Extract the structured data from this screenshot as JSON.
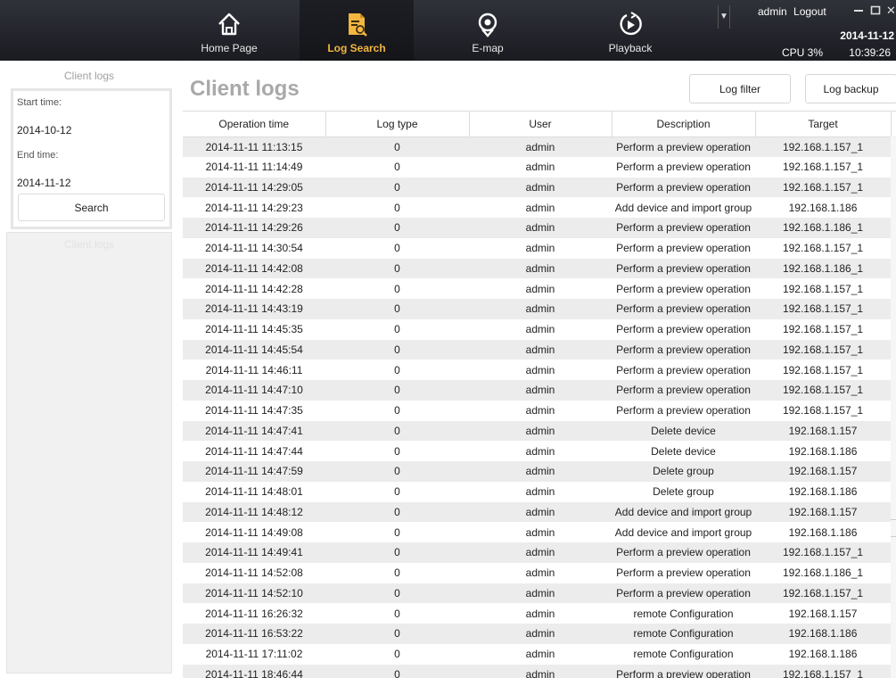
{
  "nav": {
    "items": [
      {
        "label": "Home Page",
        "icon": "home-icon"
      },
      {
        "label": "Log Search",
        "icon": "log-search-icon"
      },
      {
        "label": "E-map",
        "icon": "map-pin-icon"
      },
      {
        "label": "Playback",
        "icon": "playback-icon"
      }
    ],
    "active": "Log Search",
    "active_color": "#f3b640"
  },
  "header": {
    "user": "admin",
    "logout": "Logout",
    "date": "2014-11-12",
    "cpu": "CPU 3%",
    "time": "10:39:26"
  },
  "sidebar": {
    "title": "Client logs",
    "start_label": "Start time:",
    "start_value": "2014-10-12",
    "end_label": "End time:",
    "end_value": "2014-11-12",
    "search_label": "Search",
    "lower_title": "Client logs"
  },
  "main": {
    "title": "Client logs",
    "log_filter_label": "Log filter",
    "log_backup_label": "Log backup"
  },
  "table": {
    "columns": [
      "Operation time",
      "Log type",
      "User",
      "Description",
      "Target"
    ],
    "rows": [
      [
        "2014-11-11 11:13:15",
        "0",
        "admin",
        "Perform a preview operation",
        "192.168.1.157_1"
      ],
      [
        "2014-11-11 11:14:49",
        "0",
        "admin",
        "Perform a preview operation",
        "192.168.1.157_1"
      ],
      [
        "2014-11-11 14:29:05",
        "0",
        "admin",
        "Perform a preview operation",
        "192.168.1.157_1"
      ],
      [
        "2014-11-11 14:29:23",
        "0",
        "admin",
        "Add device and import group",
        "192.168.1.186"
      ],
      [
        "2014-11-11 14:29:26",
        "0",
        "admin",
        "Perform a preview operation",
        "192.168.1.186_1"
      ],
      [
        "2014-11-11 14:30:54",
        "0",
        "admin",
        "Perform a preview operation",
        "192.168.1.157_1"
      ],
      [
        "2014-11-11 14:42:08",
        "0",
        "admin",
        "Perform a preview operation",
        "192.168.1.186_1"
      ],
      [
        "2014-11-11 14:42:28",
        "0",
        "admin",
        "Perform a preview operation",
        "192.168.1.157_1"
      ],
      [
        "2014-11-11 14:43:19",
        "0",
        "admin",
        "Perform a preview operation",
        "192.168.1.157_1"
      ],
      [
        "2014-11-11 14:45:35",
        "0",
        "admin",
        "Perform a preview operation",
        "192.168.1.157_1"
      ],
      [
        "2014-11-11 14:45:54",
        "0",
        "admin",
        "Perform a preview operation",
        "192.168.1.157_1"
      ],
      [
        "2014-11-11 14:46:11",
        "0",
        "admin",
        "Perform a preview operation",
        "192.168.1.157_1"
      ],
      [
        "2014-11-11 14:47:10",
        "0",
        "admin",
        "Perform a preview operation",
        "192.168.1.157_1"
      ],
      [
        "2014-11-11 14:47:35",
        "0",
        "admin",
        "Perform a preview operation",
        "192.168.1.157_1"
      ],
      [
        "2014-11-11 14:47:41",
        "0",
        "admin",
        "Delete device",
        "192.168.1.157"
      ],
      [
        "2014-11-11 14:47:44",
        "0",
        "admin",
        "Delete device",
        "192.168.1.186"
      ],
      [
        "2014-11-11 14:47:59",
        "0",
        "admin",
        "Delete group",
        "192.168.1.157"
      ],
      [
        "2014-11-11 14:48:01",
        "0",
        "admin",
        "Delete group",
        "192.168.1.186"
      ],
      [
        "2014-11-11 14:48:12",
        "0",
        "admin",
        "Add device and import group",
        "192.168.1.157"
      ],
      [
        "2014-11-11 14:49:08",
        "0",
        "admin",
        "Add device and import group",
        "192.168.1.186"
      ],
      [
        "2014-11-11 14:49:41",
        "0",
        "admin",
        "Perform a preview operation",
        "192.168.1.157_1"
      ],
      [
        "2014-11-11 14:52:08",
        "0",
        "admin",
        "Perform a preview operation",
        "192.168.1.186_1"
      ],
      [
        "2014-11-11 14:52:10",
        "0",
        "admin",
        "Perform a preview operation",
        "192.168.1.157_1"
      ],
      [
        "2014-11-11 16:26:32",
        "0",
        "admin",
        "remote Configuration",
        "192.168.1.157"
      ],
      [
        "2014-11-11 16:53:22",
        "0",
        "admin",
        "remote Configuration",
        "192.168.1.186"
      ],
      [
        "2014-11-11 17:11:02",
        "0",
        "admin",
        "remote Configuration",
        "192.168.1.186"
      ],
      [
        "2014-11-11 18:46:44",
        "0",
        "admin",
        "Perform a preview operation",
        "192.168.1.157_1"
      ]
    ]
  }
}
